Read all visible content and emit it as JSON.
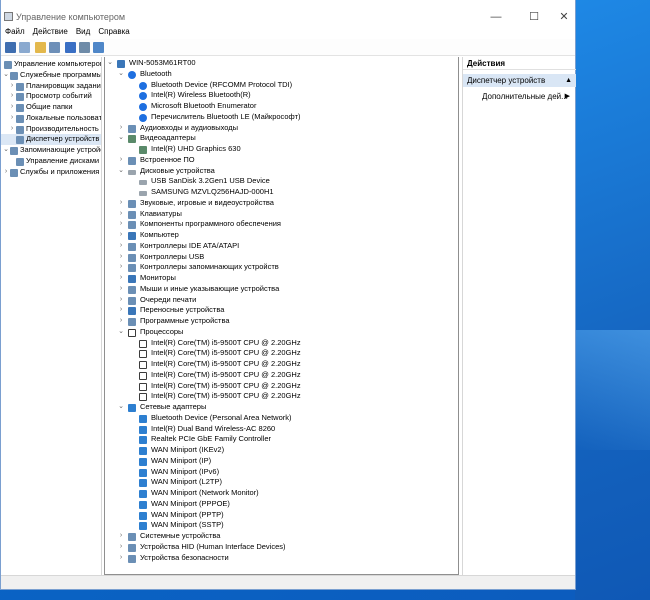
{
  "window": {
    "title": "Управление компьютером",
    "minimize_glyph": "—",
    "maximize_glyph": "☐",
    "close_glyph": "✕"
  },
  "menu": [
    "Файл",
    "Действие",
    "Вид",
    "Справка"
  ],
  "toolbar_icons": [
    "back-arrow-icon",
    "forward-arrow-icon",
    "up-folder-icon",
    "show-hide-tree-icon",
    "help-icon",
    "properties-icon",
    "monitor-icon"
  ],
  "left_tree": [
    {
      "label": "Управление компьютером (л",
      "level": 0,
      "expander": "",
      "icon": "computer-management-icon"
    },
    {
      "label": "Служебные программы",
      "level": 1,
      "expander": "⌄",
      "icon": "tools-icon"
    },
    {
      "label": "Планировщик заданий",
      "level": 2,
      "expander": "›",
      "icon": "task-scheduler-icon"
    },
    {
      "label": "Просмотр событий",
      "level": 2,
      "expander": "›",
      "icon": "event-viewer-icon"
    },
    {
      "label": "Общие папки",
      "level": 2,
      "expander": "›",
      "icon": "shared-folders-icon"
    },
    {
      "label": "Локальные пользовате",
      "level": 2,
      "expander": "›",
      "icon": "users-icon"
    },
    {
      "label": "Производительность",
      "level": 2,
      "expander": "›",
      "icon": "performance-icon"
    },
    {
      "label": "Диспетчер устройств",
      "level": 2,
      "expander": "",
      "icon": "device-manager-icon",
      "selected": true
    },
    {
      "label": "Запоминающие устройст",
      "level": 1,
      "expander": "⌄",
      "icon": "storage-icon"
    },
    {
      "label": "Управление дисками",
      "level": 2,
      "expander": "",
      "icon": "disk-management-icon"
    },
    {
      "label": "Службы и приложения",
      "level": 1,
      "expander": "›",
      "icon": "services-icon"
    }
  ],
  "device_tree": [
    {
      "label": "WIN-5053M61RT00",
      "level": 0,
      "expander": "⌄",
      "icon": "computer-icon",
      "kind": "root"
    },
    {
      "label": "Bluetooth",
      "level": 1,
      "expander": "⌄",
      "icon": "bluetooth-icon",
      "kind": "bt"
    },
    {
      "label": "Bluetooth Device (RFCOMM Protocol TDI)",
      "level": 2,
      "expander": "",
      "icon": "bluetooth-icon",
      "kind": "bt"
    },
    {
      "label": "Intel(R) Wireless Bluetooth(R)",
      "level": 2,
      "expander": "",
      "icon": "bluetooth-icon",
      "kind": "bt"
    },
    {
      "label": "Microsoft Bluetooth Enumerator",
      "level": 2,
      "expander": "",
      "icon": "bluetooth-icon",
      "kind": "bt"
    },
    {
      "label": "Перечислитель Bluetooth LE (Майкрософт)",
      "level": 2,
      "expander": "",
      "icon": "bluetooth-icon",
      "kind": "bt"
    },
    {
      "label": "Аудиовходы и аудиовыходы",
      "level": 1,
      "expander": "›",
      "icon": "audio-io-icon",
      "kind": "gen"
    },
    {
      "label": "Видеоадаптеры",
      "level": 1,
      "expander": "⌄",
      "icon": "display-adapter-icon",
      "kind": "gpu"
    },
    {
      "label": "Intel(R) UHD Graphics 630",
      "level": 2,
      "expander": "",
      "icon": "display-adapter-icon",
      "kind": "gpu"
    },
    {
      "label": "Встроенное ПО",
      "level": 1,
      "expander": "›",
      "icon": "firmware-icon",
      "kind": "gen"
    },
    {
      "label": "Дисковые устройства",
      "level": 1,
      "expander": "⌄",
      "icon": "disk-drive-icon",
      "kind": "disk"
    },
    {
      "label": "USB  SanDisk 3.2Gen1 USB Device",
      "level": 2,
      "expander": "",
      "icon": "disk-drive-icon",
      "kind": "disk"
    },
    {
      "label": "SAMSUNG MZVLQ256HAJD-000H1",
      "level": 2,
      "expander": "",
      "icon": "disk-drive-icon",
      "kind": "disk"
    },
    {
      "label": "Звуковые, игровые и видеоустройства",
      "level": 1,
      "expander": "›",
      "icon": "sound-icon",
      "kind": "gen"
    },
    {
      "label": "Клавиатуры",
      "level": 1,
      "expander": "›",
      "icon": "keyboard-icon",
      "kind": "gen"
    },
    {
      "label": "Компоненты программного обеспечения",
      "level": 1,
      "expander": "›",
      "icon": "software-component-icon",
      "kind": "gen"
    },
    {
      "label": "Компьютер",
      "level": 1,
      "expander": "›",
      "icon": "computer-icon",
      "kind": "root"
    },
    {
      "label": "Контроллеры IDE ATA/ATAPI",
      "level": 1,
      "expander": "›",
      "icon": "ide-controller-icon",
      "kind": "gen"
    },
    {
      "label": "Контроллеры USB",
      "level": 1,
      "expander": "›",
      "icon": "usb-controller-icon",
      "kind": "gen"
    },
    {
      "label": "Контроллеры запоминающих устройств",
      "level": 1,
      "expander": "›",
      "icon": "storage-controller-icon",
      "kind": "gen"
    },
    {
      "label": "Мониторы",
      "level": 1,
      "expander": "›",
      "icon": "monitor-icon",
      "kind": "root"
    },
    {
      "label": "Мыши и иные указывающие устройства",
      "level": 1,
      "expander": "›",
      "icon": "mouse-icon",
      "kind": "gen"
    },
    {
      "label": "Очереди печати",
      "level": 1,
      "expander": "›",
      "icon": "printer-icon",
      "kind": "gen"
    },
    {
      "label": "Переносные устройства",
      "level": 1,
      "expander": "›",
      "icon": "portable-device-icon",
      "kind": "root"
    },
    {
      "label": "Программные устройства",
      "level": 1,
      "expander": "›",
      "icon": "software-device-icon",
      "kind": "gen"
    },
    {
      "label": "Процессоры",
      "level": 1,
      "expander": "⌄",
      "icon": "processor-icon",
      "kind": "cpu"
    },
    {
      "label": "Intel(R) Core(TM) i5-9500T CPU @ 2.20GHz",
      "level": 2,
      "expander": "",
      "icon": "processor-icon",
      "kind": "cpu"
    },
    {
      "label": "Intel(R) Core(TM) i5-9500T CPU @ 2.20GHz",
      "level": 2,
      "expander": "",
      "icon": "processor-icon",
      "kind": "cpu"
    },
    {
      "label": "Intel(R) Core(TM) i5-9500T CPU @ 2.20GHz",
      "level": 2,
      "expander": "",
      "icon": "processor-icon",
      "kind": "cpu"
    },
    {
      "label": "Intel(R) Core(TM) i5-9500T CPU @ 2.20GHz",
      "level": 2,
      "expander": "",
      "icon": "processor-icon",
      "kind": "cpu"
    },
    {
      "label": "Intel(R) Core(TM) i5-9500T CPU @ 2.20GHz",
      "level": 2,
      "expander": "",
      "icon": "processor-icon",
      "kind": "cpu"
    },
    {
      "label": "Intel(R) Core(TM) i5-9500T CPU @ 2.20GHz",
      "level": 2,
      "expander": "",
      "icon": "processor-icon",
      "kind": "cpu"
    },
    {
      "label": "Сетевые адаптеры",
      "level": 1,
      "expander": "⌄",
      "icon": "network-adapter-icon",
      "kind": "net"
    },
    {
      "label": "Bluetooth Device (Personal Area Network)",
      "level": 2,
      "expander": "",
      "icon": "network-adapter-icon",
      "kind": "net"
    },
    {
      "label": "Intel(R) Dual Band Wireless-AC 8260",
      "level": 2,
      "expander": "",
      "icon": "network-adapter-icon",
      "kind": "net"
    },
    {
      "label": "Realtek PCIe GbE Family Controller",
      "level": 2,
      "expander": "",
      "icon": "network-adapter-icon",
      "kind": "net"
    },
    {
      "label": "WAN Miniport (IKEv2)",
      "level": 2,
      "expander": "",
      "icon": "network-adapter-icon",
      "kind": "net"
    },
    {
      "label": "WAN Miniport (IP)",
      "level": 2,
      "expander": "",
      "icon": "network-adapter-icon",
      "kind": "net"
    },
    {
      "label": "WAN Miniport (IPv6)",
      "level": 2,
      "expander": "",
      "icon": "network-adapter-icon",
      "kind": "net"
    },
    {
      "label": "WAN Miniport (L2TP)",
      "level": 2,
      "expander": "",
      "icon": "network-adapter-icon",
      "kind": "net"
    },
    {
      "label": "WAN Miniport (Network Monitor)",
      "level": 2,
      "expander": "",
      "icon": "network-adapter-icon",
      "kind": "net"
    },
    {
      "label": "WAN Miniport (PPPOE)",
      "level": 2,
      "expander": "",
      "icon": "network-adapter-icon",
      "kind": "net"
    },
    {
      "label": "WAN Miniport (PPTP)",
      "level": 2,
      "expander": "",
      "icon": "network-adapter-icon",
      "kind": "net"
    },
    {
      "label": "WAN Miniport (SSTP)",
      "level": 2,
      "expander": "",
      "icon": "network-adapter-icon",
      "kind": "net"
    },
    {
      "label": "Системные устройства",
      "level": 1,
      "expander": "›",
      "icon": "system-device-icon",
      "kind": "gen"
    },
    {
      "label": "Устройства HID (Human Interface Devices)",
      "level": 1,
      "expander": "›",
      "icon": "hid-icon",
      "kind": "gen"
    },
    {
      "label": "Устройства безопасности",
      "level": 1,
      "expander": "›",
      "icon": "security-device-icon",
      "kind": "gen"
    }
  ],
  "actions": {
    "header": "Действия",
    "section": "Диспетчер устройств",
    "section_glyph": "▲",
    "more": "Дополнительные дей...",
    "more_glyph": "▶"
  }
}
